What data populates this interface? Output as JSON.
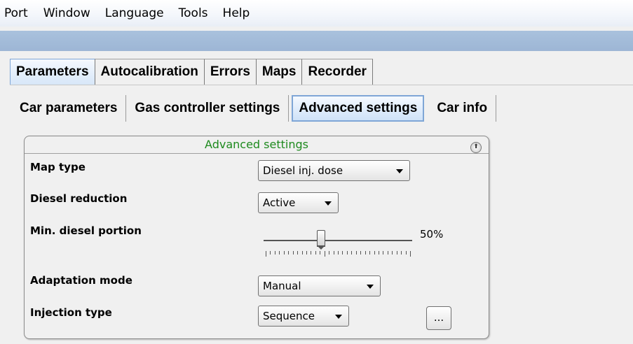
{
  "menu": [
    "Port",
    "Window",
    "Language",
    "Tools",
    "Help"
  ],
  "tabs": [
    "Parameters",
    "Autocalibration",
    "Errors",
    "Maps",
    "Recorder"
  ],
  "active_tab": "Parameters",
  "subtabs": [
    "Car parameters",
    "Gas controller settings",
    "Advanced settings",
    "Car info"
  ],
  "active_subtab": "Advanced settings",
  "panel": {
    "title": "Advanced settings",
    "map_type": {
      "label": "Map type",
      "value": "Diesel inj. dose"
    },
    "diesel_reduction": {
      "label": "Diesel reduction",
      "value": "Active"
    },
    "min_diesel_portion": {
      "label": "Min. diesel portion",
      "value_text": "50%",
      "value": 50
    },
    "adaptation_mode": {
      "label": "Adaptation mode",
      "value": "Manual"
    },
    "injection_type": {
      "label": "Injection type",
      "value": "Sequence"
    },
    "more_button": "..."
  },
  "colors": {
    "panel_title": "#1e8a1e",
    "strip": "#a9c1dd",
    "active_tab": "#d6e6f8"
  }
}
